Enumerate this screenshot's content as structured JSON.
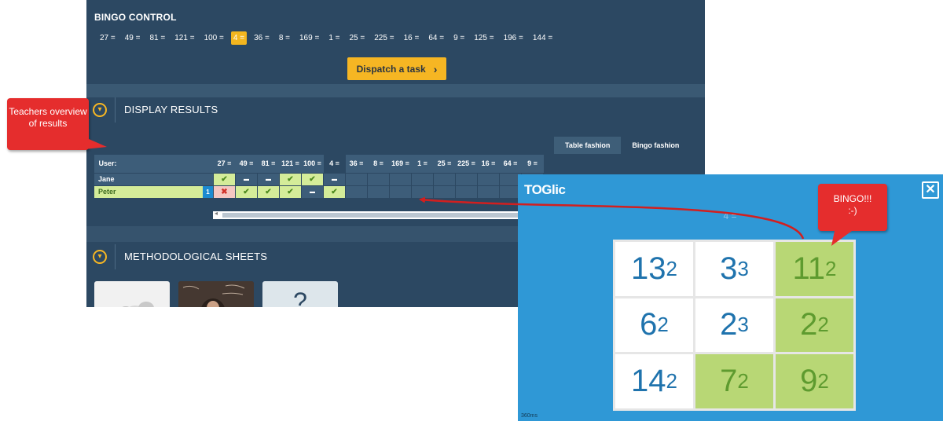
{
  "bingo_control": {
    "title": "BINGO CONTROL",
    "chips": [
      "27 =",
      "49 =",
      "81 =",
      "121 =",
      "100 =",
      "4 =",
      "36 =",
      "8 =",
      "169 =",
      "1 =",
      "25 =",
      "225 =",
      "16 =",
      "64 =",
      "9 =",
      "125 =",
      "196 =",
      "144 ="
    ],
    "active_chip_index": 5,
    "dispatch_label": "Dispatch a task",
    "dispatch_icon": "chevron-right-icon"
  },
  "display_results": {
    "title": "DISPLAY RESULTS",
    "tabs": [
      "Table fashion",
      "Bingo fashion"
    ],
    "active_tab": "Table fashion",
    "user_header": "User:",
    "columns": [
      "27 =",
      "49 =",
      "81 =",
      "121 =",
      "100 =",
      "4 =",
      "36 =",
      "8 =",
      "169 =",
      "1 =",
      "25 =",
      "225 =",
      "16 =",
      "64 =",
      "9 ="
    ],
    "rows": [
      {
        "name": "Jane",
        "badge": "",
        "cells": [
          "ok",
          "dash",
          "dash",
          "ok",
          "ok",
          "dash",
          "",
          "",
          "",
          "",
          "",
          "",
          "",
          "",
          ""
        ]
      },
      {
        "name": "Peter",
        "badge": "1",
        "cells": [
          "err",
          "ok",
          "ok",
          "ok",
          "dash",
          "ok",
          "",
          "",
          "",
          "",
          "",
          "",
          "",
          "",
          ""
        ]
      }
    ]
  },
  "methodological_sheets": {
    "title": "METHODOLOGICAL SHEETS",
    "thumb_3_text": "?"
  },
  "callouts": {
    "teacher": "Teachers overview of results",
    "bingo_line1": "BINGO!!!",
    "bingo_line2": ":-)"
  },
  "popup": {
    "logo": "TOGlic",
    "current_task": "4 =",
    "grid": [
      {
        "base": "13",
        "exp": "2",
        "hit": false
      },
      {
        "base": "3",
        "exp": "3",
        "hit": false
      },
      {
        "base": "11",
        "exp": "2",
        "hit": true
      },
      {
        "base": "6",
        "exp": "2",
        "hit": false
      },
      {
        "base": "2",
        "exp": "3",
        "hit": false
      },
      {
        "base": "2",
        "exp": "2",
        "hit": true
      },
      {
        "base": "14",
        "exp": "2",
        "hit": false
      },
      {
        "base": "7",
        "exp": "2",
        "hit": true
      },
      {
        "base": "9",
        "exp": "2",
        "hit": true
      }
    ],
    "timer": "360ms",
    "close_icon": "close-icon"
  },
  "colors": {
    "app_bg": "#2c4862",
    "accent": "#f6b623",
    "popup_bg": "#2f98d6",
    "hit_cell": "#b8d775",
    "callout": "#e52d2d"
  }
}
